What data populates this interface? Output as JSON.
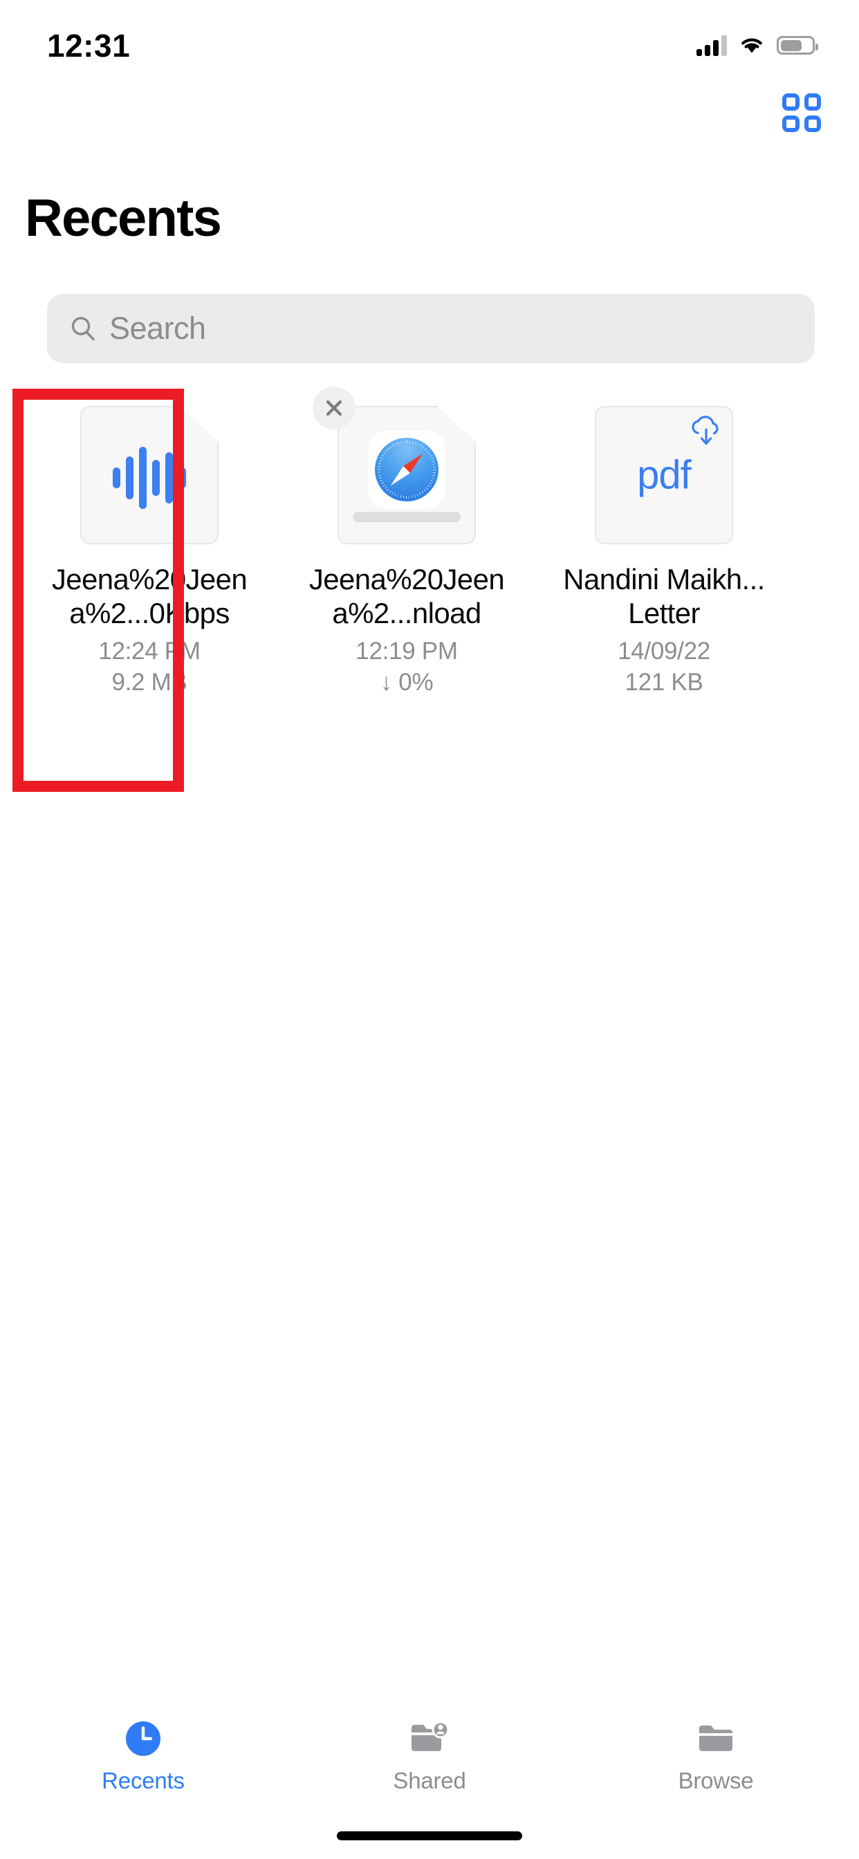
{
  "status_bar": {
    "time": "12:31",
    "cellular_icon": "cellular-signal-icon",
    "wifi_icon": "wifi-icon",
    "battery_icon": "battery-icon"
  },
  "nav_bar": {
    "grid_view_icon": "grid-view-icon"
  },
  "header": {
    "title": "Recents"
  },
  "search": {
    "placeholder": "Search",
    "value": "",
    "icon": "search-icon"
  },
  "files": [
    {
      "name": "Jeena%20Jeena%2...0Kbps",
      "meta_primary": "12:24 PM",
      "meta_secondary": "9.2 MB",
      "icon": "audio-waveform-icon",
      "kind": "audio",
      "selected": true,
      "waveform_bars": [
        30,
        62,
        90,
        52,
        74,
        30
      ]
    },
    {
      "name": "Jeena%20Jeena%2...nload",
      "meta_primary": "12:19 PM",
      "meta_secondary": "↓ 0%",
      "icon": "safari-compass-icon",
      "kind": "download",
      "close_icon": "close-icon",
      "progress_percent": 0,
      "selected": false
    },
    {
      "name": "Nandini Maikh...Letter",
      "meta_primary": "14/09/22",
      "meta_secondary": "121 KB",
      "icon": "pdf-file-icon",
      "badge_icon": "icloud-download-icon",
      "kind": "pdf",
      "label": "pdf",
      "selected": false
    }
  ],
  "tabs": [
    {
      "label": "Recents",
      "icon": "clock-icon",
      "active": true
    },
    {
      "label": "Shared",
      "icon": "shared-folder-icon",
      "active": false
    },
    {
      "label": "Browse",
      "icon": "folder-icon",
      "active": false
    }
  ],
  "colors": {
    "accent": "#2f7cf6",
    "highlight": "#ec1c24",
    "muted_text": "#8c8c90",
    "search_bg": "#ebebec"
  }
}
